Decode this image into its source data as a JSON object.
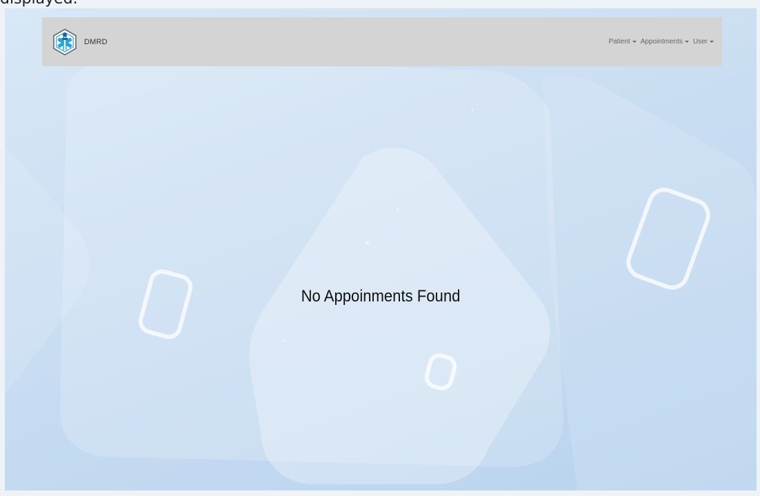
{
  "caption": {
    "text": "displayed."
  },
  "brand": {
    "name": "DMRD",
    "logo_icon": "medical-star-of-life-icon",
    "logo_color": "#2aa5d6"
  },
  "nav": {
    "items": [
      {
        "label": "Patient",
        "icon": "caret-down-icon"
      },
      {
        "label": "Appointments",
        "icon": "caret-down-icon"
      },
      {
        "label": "User",
        "icon": "caret-down-icon"
      }
    ],
    "background": "#d4d4d4"
  },
  "main": {
    "empty_message": "No Appoinments Found"
  },
  "colors": {
    "page_background": "#c9ddf2",
    "accent": "#2aa5d6"
  }
}
